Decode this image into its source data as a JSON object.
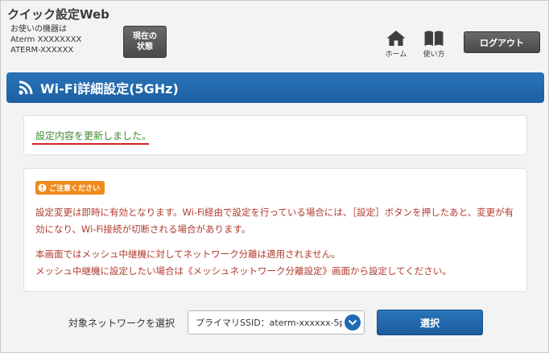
{
  "header": {
    "app_title": "クイック設定Web",
    "device_label": "お使いの機器は",
    "device_model": "Aterm XXXXXXXX",
    "device_name": "ATERM-XXXXXX",
    "status_button_line1": "現在の",
    "status_button_line2": "状態",
    "home_label": "ホーム",
    "home_icon": "home-icon",
    "manual_label": "使い方",
    "manual_icon": "book-icon",
    "logout_label": "ログアウト"
  },
  "page": {
    "title": "Wi-Fi詳細設定(5GHz)",
    "title_icon": "wifi-icon",
    "accent_color": "#1f6bb3"
  },
  "success": {
    "message": "設定内容を更新しました。",
    "color": "#3f8a2f"
  },
  "notice": {
    "badge": "ご注意ください",
    "badge_color": "#f08a1c",
    "paragraph1": "設定変更は即時に有効となります。Wi-Fi経由で設定を行っている場合には、［設定］ボタンを押したあと、変更が有効になり、Wi-Fi接続が切断される場合があります。",
    "paragraph2_line1": "本画面ではメッシュ中継機に対してネットワーク分離は適用されません。",
    "paragraph2_line2": "メッシュ中継機に設定したい場合は《メッシュネットワーク分離設定》画面から設定してください。",
    "text_color": "#b03a2e"
  },
  "network_select": {
    "label": "対象ネットワークを選択",
    "value": "プライマリSSID：aterm-xxxxxx-5p",
    "button_label": "選択"
  }
}
